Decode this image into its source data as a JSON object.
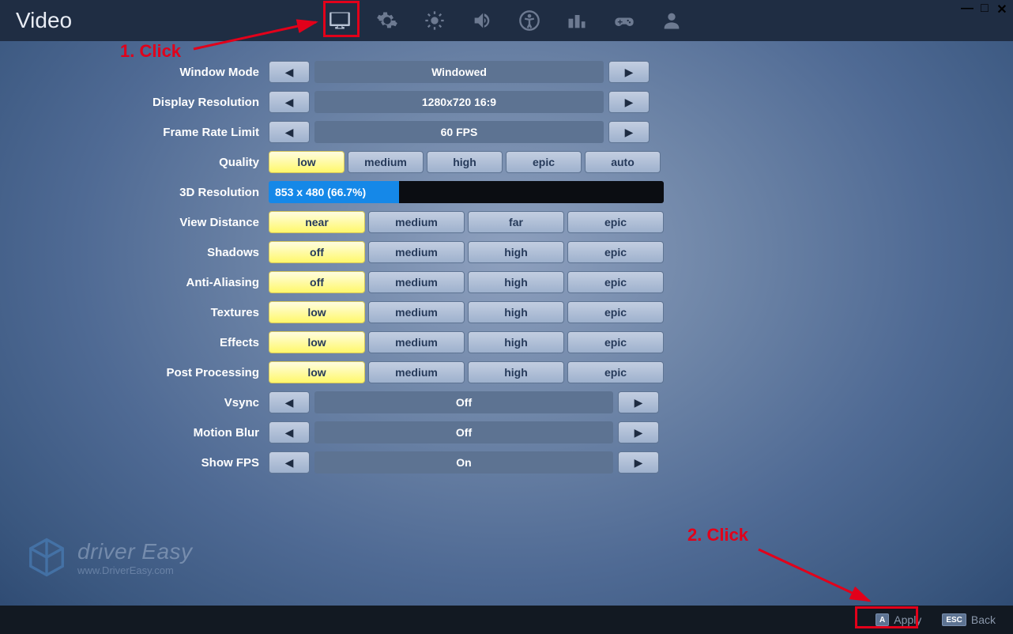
{
  "header": {
    "title": "Video"
  },
  "annotations": {
    "step1": "1. Click",
    "step2": "2. Click"
  },
  "rows": {
    "windowMode": {
      "label": "Window Mode",
      "value": "Windowed"
    },
    "resolution": {
      "label": "Display Resolution",
      "value": "1280x720 16:9"
    },
    "frameRate": {
      "label": "Frame Rate Limit",
      "value": "60 FPS"
    },
    "quality": {
      "label": "Quality",
      "opts": [
        "low",
        "medium",
        "high",
        "epic",
        "auto"
      ],
      "selected": "low"
    },
    "resolution3d": {
      "label": "3D Resolution",
      "value": "853 x 480 (66.7%)"
    },
    "viewDistance": {
      "label": "View Distance",
      "opts": [
        "near",
        "medium",
        "far",
        "epic"
      ],
      "selected": "near"
    },
    "shadows": {
      "label": "Shadows",
      "opts": [
        "off",
        "medium",
        "high",
        "epic"
      ],
      "selected": "off"
    },
    "antiAliasing": {
      "label": "Anti-Aliasing",
      "opts": [
        "off",
        "medium",
        "high",
        "epic"
      ],
      "selected": "off"
    },
    "textures": {
      "label": "Textures",
      "opts": [
        "low",
        "medium",
        "high",
        "epic"
      ],
      "selected": "low"
    },
    "effects": {
      "label": "Effects",
      "opts": [
        "low",
        "medium",
        "high",
        "epic"
      ],
      "selected": "low"
    },
    "postProcessing": {
      "label": "Post Processing",
      "opts": [
        "low",
        "medium",
        "high",
        "epic"
      ],
      "selected": "low"
    },
    "vsync": {
      "label": "Vsync",
      "value": "Off"
    },
    "motionBlur": {
      "label": "Motion Blur",
      "value": "Off"
    },
    "showFps": {
      "label": "Show FPS",
      "value": "On"
    }
  },
  "bottom": {
    "apply": {
      "key": "A",
      "label": "Apply"
    },
    "back": {
      "key": "ESC",
      "label": "Back"
    }
  },
  "watermark": {
    "line1": "driver Easy",
    "line2": "www.DriverEasy.com"
  }
}
